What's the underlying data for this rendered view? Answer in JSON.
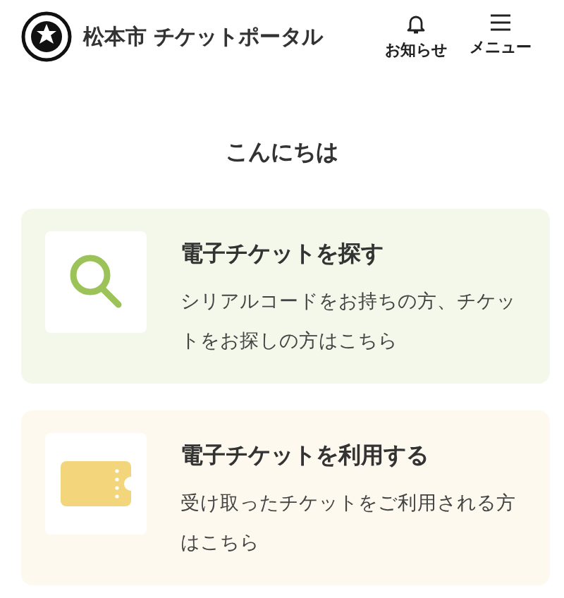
{
  "header": {
    "title": "松本市 チケットポータル",
    "actions": [
      {
        "kind": "bell",
        "label": "お知らせ"
      },
      {
        "kind": "menu",
        "label": "メニュー"
      }
    ]
  },
  "greeting": "こんにちは",
  "cards": [
    {
      "kind": "search",
      "color": "#f3f8ea",
      "title": "電子チケットを探す",
      "description": "シリアルコードをお持ちの方、チケットをお探しの方はこちら"
    },
    {
      "kind": "ticket",
      "color": "#fdf9ee",
      "title": "電子チケットを利用する",
      "description": "受け取ったチケットをご利用される方はこちら"
    }
  ]
}
